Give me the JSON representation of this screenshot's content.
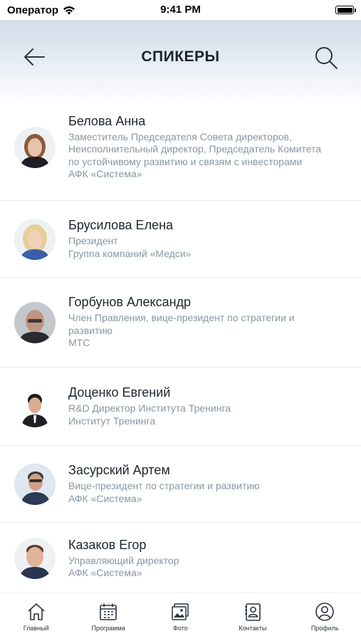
{
  "status_bar": {
    "carrier": "Оператор",
    "time": "9:41 PM"
  },
  "header": {
    "title": "СПИКЕРЫ"
  },
  "speakers": [
    {
      "name": "Белова Анна",
      "role": "Заместитель Председателя Совета директоров, Неисполнительный директор, Председатель Комитета по устойчивому развитию и связям с инвесторами",
      "company": "АФК «Система»"
    },
    {
      "name": "Брусилова Елена",
      "role": "Президент",
      "company": "Группа компаний «Медси»"
    },
    {
      "name": "Горбунов Александр",
      "role": "Член Правления, вице-президент по стратегии и развитию",
      "company": "МТС"
    },
    {
      "name": "Доценко Евгений",
      "role": "R&D Директор Института Тренинга",
      "company": "Институт Тренинга"
    },
    {
      "name": "Засурский Артем",
      "role": "Вице-президент по стратегии и развитию",
      "company": "АФК «Система»"
    },
    {
      "name": "Казаков Егор",
      "role": "Управляющий директор",
      "company": "АФК «Система»"
    }
  ],
  "tabbar": {
    "home": "Главный",
    "program": "Программа",
    "photo": "Фото",
    "contacts": "Контакты",
    "profile": "Профиль"
  }
}
